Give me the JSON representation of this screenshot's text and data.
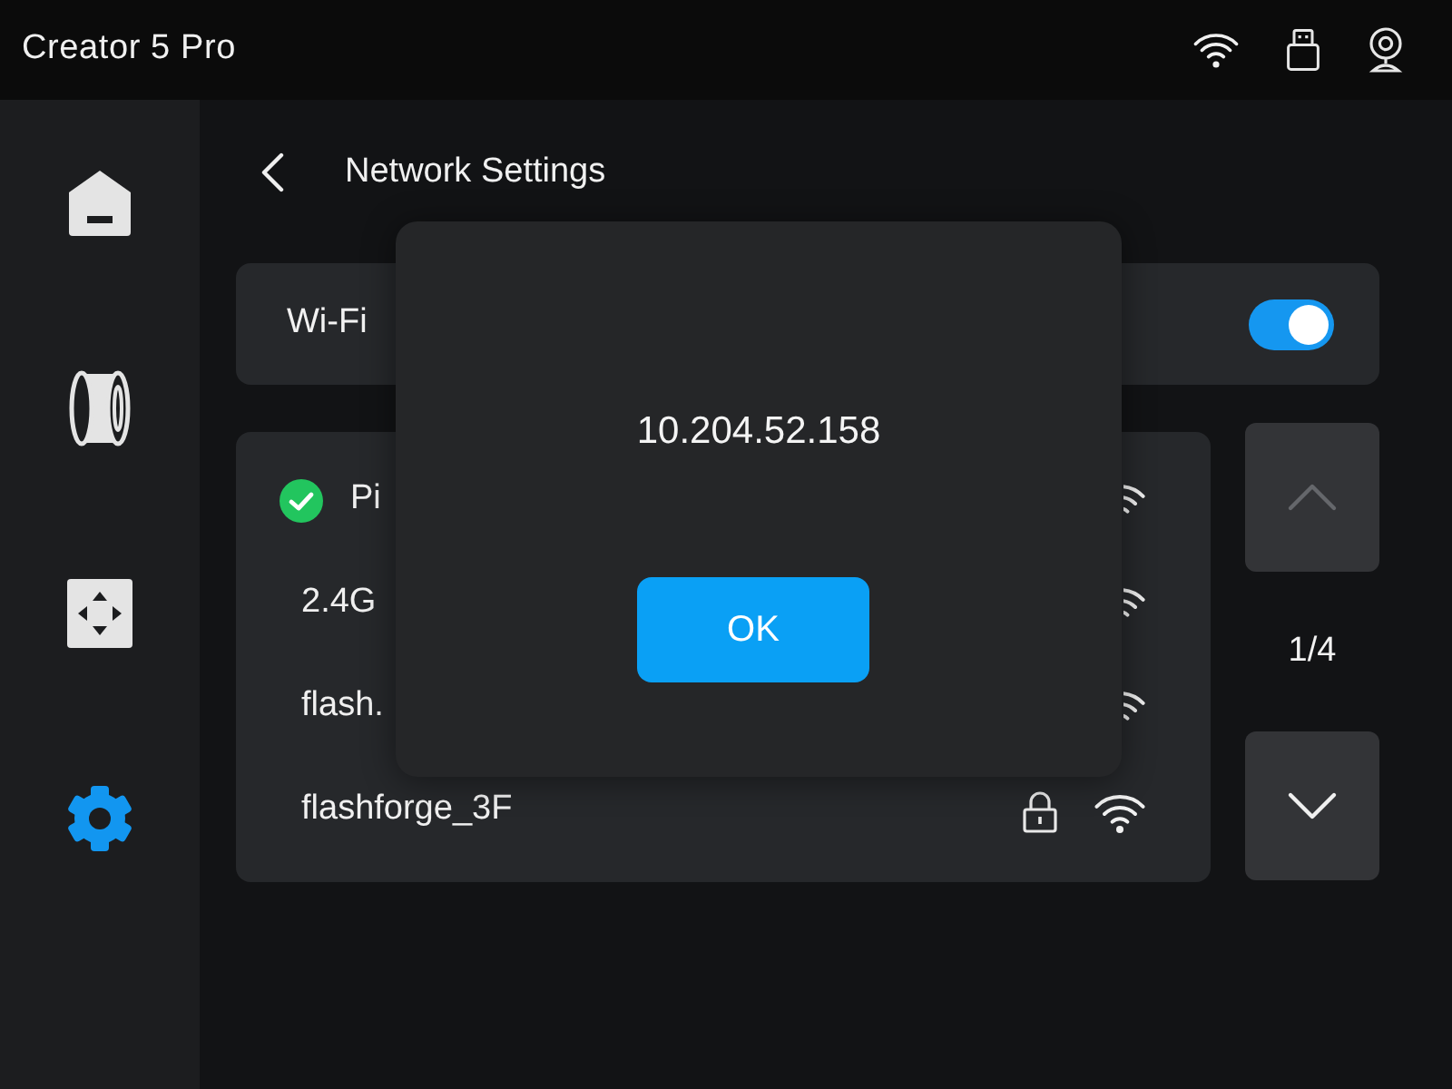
{
  "top_bar": {
    "title": "Creator 5 Pro"
  },
  "sidebar": {
    "items": [
      {
        "kind": "home",
        "selected": false
      },
      {
        "kind": "filament",
        "selected": false
      },
      {
        "kind": "move",
        "selected": false
      },
      {
        "kind": "settings",
        "selected": true
      }
    ]
  },
  "header": {
    "title": "Network Settings"
  },
  "wifi": {
    "label": "Wi-Fi",
    "on": true
  },
  "networks": [
    {
      "name": "Pi",
      "connected": true
    },
    {
      "name": "2.4G",
      "connected": false
    },
    {
      "name": "flash.",
      "connected": false
    },
    {
      "name": "flashforge_3F",
      "connected": false,
      "locked": true
    }
  ],
  "pager": {
    "label": "1/4",
    "buttons": [
      {
        "kind": "up",
        "disabled": true
      },
      {
        "kind": "down",
        "disabled": false
      }
    ]
  },
  "dialog": {
    "message": "10.204.52.158",
    "button": "OK"
  }
}
